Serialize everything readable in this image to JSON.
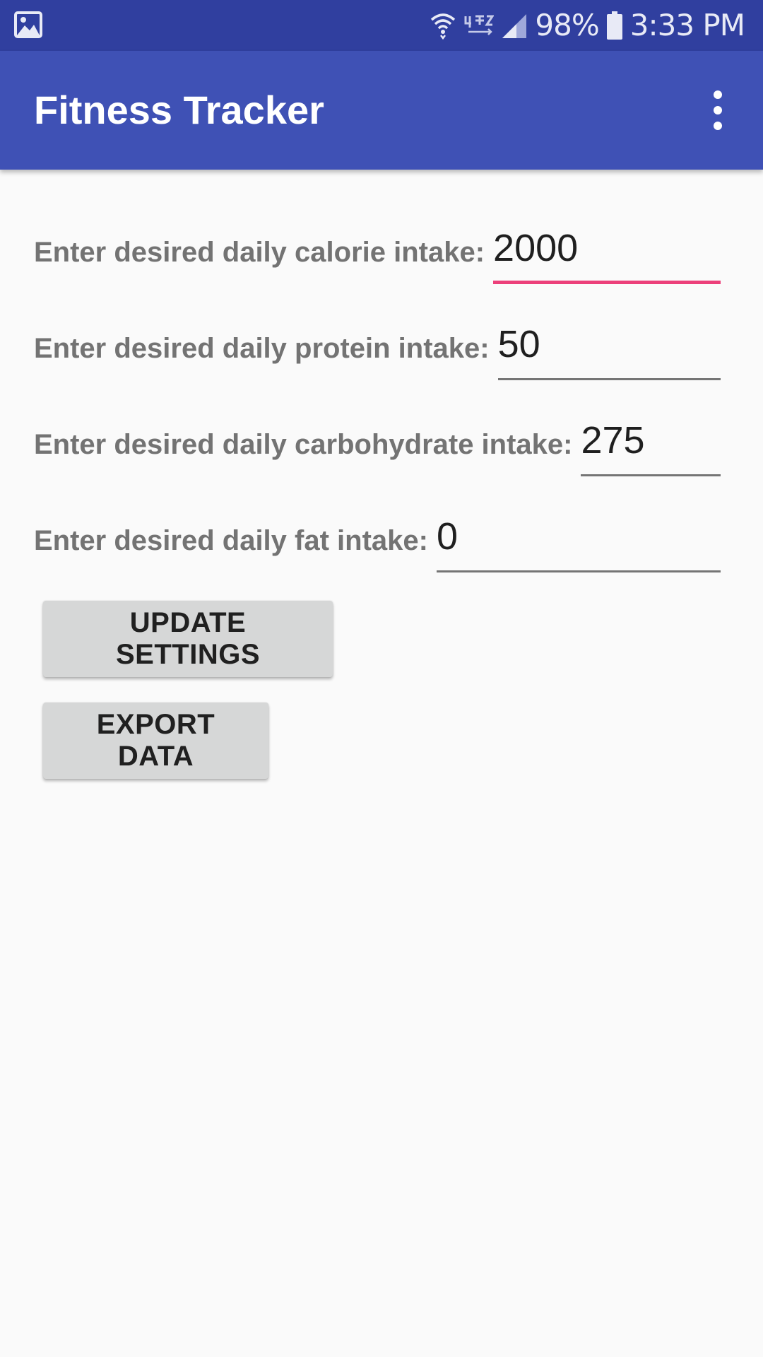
{
  "status_bar": {
    "battery": "98%",
    "time": "3:33 PM",
    "icons": [
      "gallery-icon",
      "wifi-icon",
      "volte-icon",
      "signal-icon",
      "battery-icon"
    ]
  },
  "app_bar": {
    "title": "Fitness Tracker",
    "menu_icon": "overflow-menu-icon"
  },
  "form": {
    "calorie": {
      "label": "Enter desired daily calorie intake:",
      "value": "2000"
    },
    "protein": {
      "label": "Enter desired daily protein intake:",
      "value": "50"
    },
    "carbohydrate": {
      "label": "Enter desired daily carbohydrate intake:",
      "value": "275"
    },
    "fat": {
      "label": "Enter desired daily fat intake:",
      "value": "0"
    }
  },
  "buttons": {
    "update_label": "UPDATE SETTINGS",
    "export_label": "EXPORT DATA"
  },
  "colors": {
    "status_bar": "#303f9f",
    "app_bar": "#3f51b5",
    "accent": "#ec407a",
    "background": "#fafafa"
  }
}
